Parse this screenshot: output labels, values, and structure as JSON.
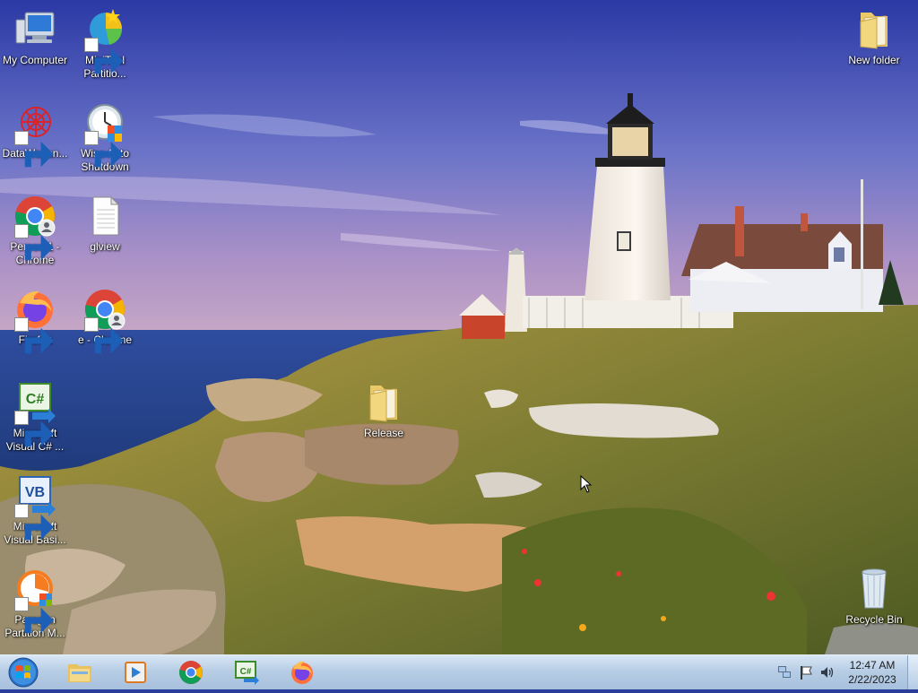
{
  "desktop": {
    "icons": [
      {
        "label": "My Computer",
        "icon": "computer-icon"
      },
      {
        "label": "MiniTool\nPartitio...",
        "icon": "minitool-icon"
      },
      {
        "label": "DataWagon...",
        "icon": "datawagon-icon"
      },
      {
        "label": "Wise Auto\nShutdown",
        "icon": "wise-shutdown-icon"
      },
      {
        "label": "Person 1 -\nChrome",
        "icon": "chrome-icon"
      },
      {
        "label": "glview",
        "icon": "file-icon"
      },
      {
        "label": "Firefox",
        "icon": "firefox-icon"
      },
      {
        "label": "e - Chrome",
        "icon": "chrome-icon"
      },
      {
        "label": "Microsoft\nVisual C# ...",
        "icon": "visual-csharp-icon"
      },
      {
        "label": "Microsoft\nVisual Basi...",
        "icon": "visual-basic-icon"
      },
      {
        "label": "Paragon\nPartition M...",
        "icon": "paragon-icon"
      },
      {
        "label": "New folder",
        "icon": "folder-icon"
      },
      {
        "label": "Release",
        "icon": "folder-icon"
      },
      {
        "label": "Recycle Bin",
        "icon": "recycle-bin-icon"
      }
    ]
  },
  "taskbar": {
    "pinned": [
      "explorer-icon",
      "media-player-icon",
      "chrome-icon",
      "visual-csharp-icon",
      "firefox-icon"
    ],
    "tray": [
      "network-icon",
      "action-center-flag-icon",
      "volume-icon"
    ],
    "clock": {
      "time": "12:47 AM",
      "date": "2/22/2023"
    }
  },
  "colors": {
    "sky_top": "#2c3aa6",
    "sky_bottom": "#9b86c9",
    "sea": "#2a4f9c",
    "grass": "#8f8a3a",
    "taskbar": "#b7cde5"
  }
}
